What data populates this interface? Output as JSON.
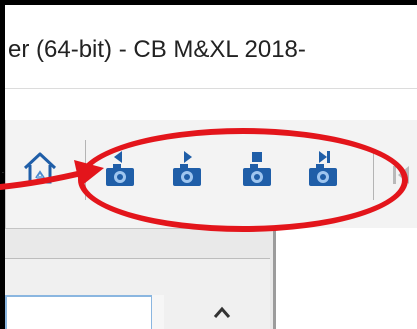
{
  "window": {
    "title": "er (64-bit) - CB M&XL 2018-"
  },
  "toolbar": {
    "buttons": [
      {
        "name": "home-button",
        "icon": "home-icon"
      },
      {
        "name": "camera-prev-button",
        "icon": "camera-previous-icon"
      },
      {
        "name": "camera-play-button",
        "icon": "camera-play-icon"
      },
      {
        "name": "camera-stop-button",
        "icon": "camera-stop-icon"
      },
      {
        "name": "camera-next-button",
        "icon": "camera-next-icon"
      },
      {
        "name": "go-first-button",
        "icon": "skip-to-start-icon"
      }
    ]
  },
  "colors": {
    "highlight": "#e3151b",
    "icon_blue": "#1f5ea8",
    "field_border": "#8ab6e0"
  }
}
